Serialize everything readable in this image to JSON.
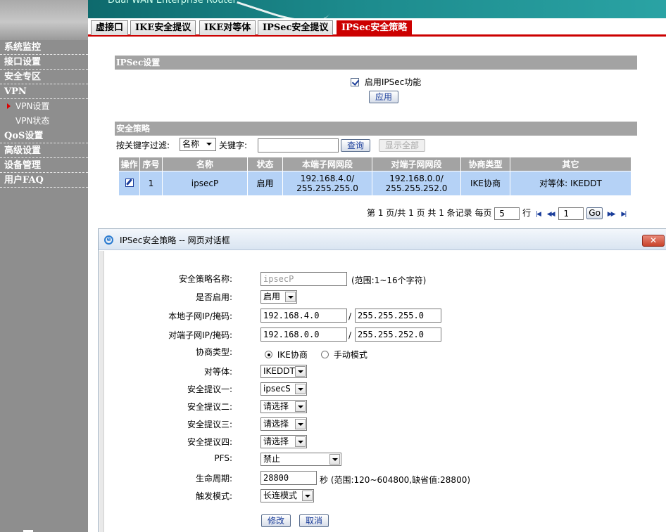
{
  "header": {
    "brand": "Dual WAN Enterprise Router"
  },
  "sidebar": {
    "items": [
      {
        "label": "系统监控"
      },
      {
        "label": "接口设置"
      },
      {
        "label": "安全专区"
      },
      {
        "label": "VPN"
      },
      {
        "label": "VPN设置",
        "sub": true,
        "active": true
      },
      {
        "label": "VPN状态",
        "sub": true
      },
      {
        "label": "QoS设置"
      },
      {
        "label": "高级设置"
      },
      {
        "label": "设备管理"
      },
      {
        "label": "用户FAQ"
      }
    ]
  },
  "tabs": [
    {
      "label": "虚接口"
    },
    {
      "label": "IKE安全提议"
    },
    {
      "label": "IKE对等体"
    },
    {
      "label": "IPSec安全提议"
    },
    {
      "label": "IPSec安全策略",
      "active": true
    }
  ],
  "ipsec_settings": {
    "title": "IPSec设置",
    "enable_label": "启用IPSec功能",
    "enable_checked": true,
    "apply_button": "应用"
  },
  "policy": {
    "title": "安全策略",
    "filter_label": "按关键字过滤:",
    "filter_field": "名称",
    "keyword_label": "关键字:",
    "keyword_value": "",
    "search_button": "查询",
    "show_all_button": "显示全部",
    "columns": [
      "操作",
      "序号",
      "名称",
      "状态",
      "本端子网网段",
      "对端子网网段",
      "协商类型",
      "其它"
    ],
    "rows": [
      {
        "seq": "1",
        "name": "ipsecP",
        "status": "启用",
        "local_ip": "192.168.4.0/",
        "local_mask": "255.255.255.0",
        "remote_ip": "192.168.0.0/",
        "remote_mask": "255.255.252.0",
        "type": "IKE协商",
        "other": "对等体: IKEDDT"
      }
    ],
    "pager": {
      "page_text": "第 1 页/共 1 页 共 1 条记录 每页",
      "per_page": "5",
      "rows_label": "行",
      "goto_value": "1",
      "go_button": "Go"
    }
  },
  "dialog": {
    "title": "IPSec安全策略 -- 网页对话框",
    "close_label": "✕",
    "fields": {
      "name_label": "安全策略名称:",
      "name_value": "ipsecP",
      "name_hint": "(范围:1~16个字符)",
      "enable_label": "是否启用:",
      "enable_value": "启用",
      "local_label": "本地子网IP/掩码:",
      "local_ip": "192.168.4.0",
      "local_mask": "255.255.255.0",
      "remote_label": "对端子网IP/掩码:",
      "remote_ip": "192.168.0.0",
      "remote_mask": "255.255.252.0",
      "nego_label": "协商类型:",
      "nego_ike": "IKE协商",
      "nego_manual": "手动模式",
      "peer_label": "对等体:",
      "peer_value": "IKEDDT",
      "prop1_label": "安全提议一:",
      "prop1_value": "ipsecS",
      "prop2_label": "安全提议二:",
      "prop2_value": "请选择",
      "prop3_label": "安全提议三:",
      "prop3_value": "请选择",
      "prop4_label": "安全提议四:",
      "prop4_value": "请选择",
      "pfs_label": "PFS:",
      "pfs_value": "禁止",
      "life_label": "生命周期:",
      "life_value": "28800",
      "life_hint": "秒 (范围:120~604800,缺省值:28800)",
      "trigger_label": "触发模式:",
      "trigger_value": "长连模式",
      "slash": "/"
    },
    "modify_button": "修改",
    "cancel_button": "取消"
  }
}
